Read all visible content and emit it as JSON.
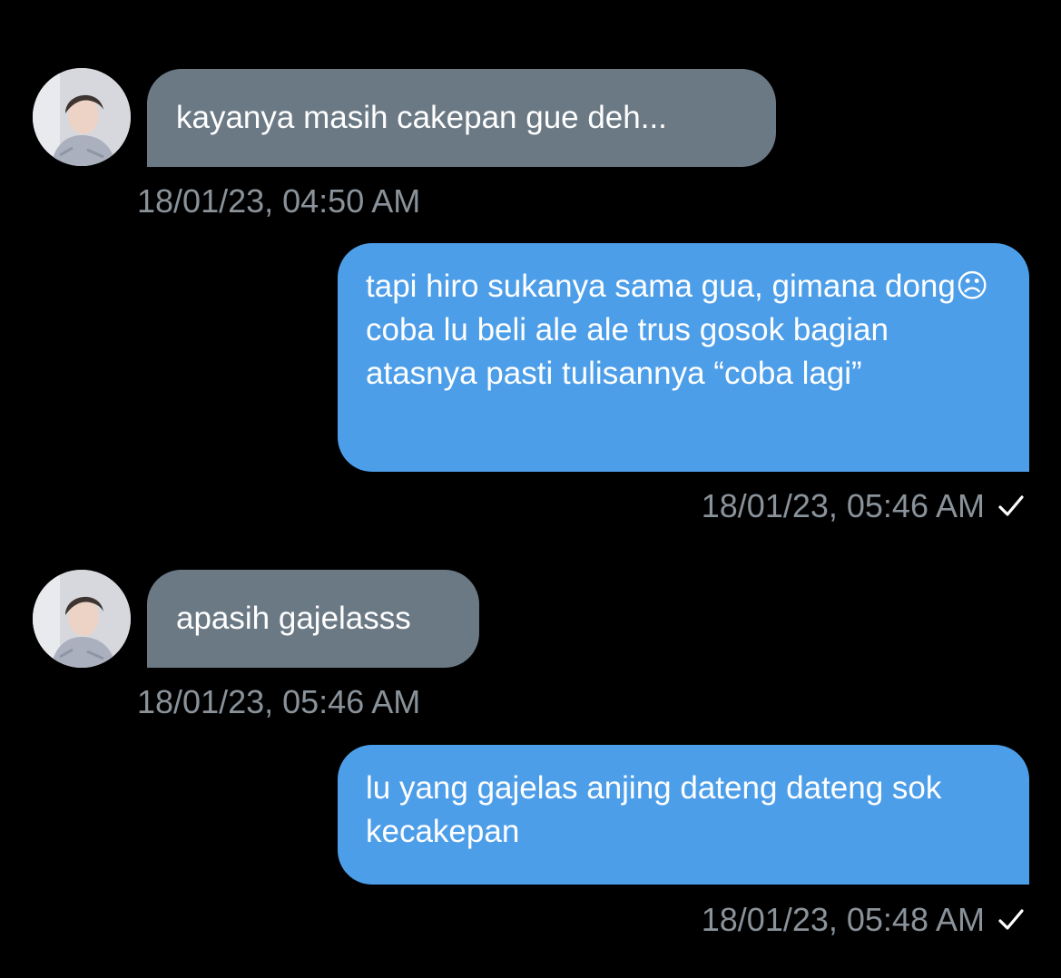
{
  "messages": [
    {
      "direction": "in",
      "text": "kayanya masih cakepan gue deh...",
      "timestamp": "18/01/23, 04:50 AM"
    },
    {
      "direction": "out",
      "text": "tapi hiro sukanya sama gua, gimana dong☹ coba lu beli ale ale trus gosok bagian atasnya pasti tulisannya “coba lagi”",
      "timestamp": "18/01/23, 05:46 AM",
      "status_icon": "check-icon"
    },
    {
      "direction": "in",
      "text": "apasih gajelasss",
      "timestamp": "18/01/23, 05:46 AM"
    },
    {
      "direction": "out",
      "text": "lu yang gajelas anjing dateng dateng sok kecakepan",
      "timestamp": "18/01/23, 05:48 AM",
      "status_icon": "check-icon"
    }
  ],
  "colors": {
    "background": "#000000",
    "incoming_bubble": "#6b7985",
    "outgoing_bubble": "#4d9ee9",
    "timestamp": "#8a929a",
    "text": "#ffffff"
  }
}
